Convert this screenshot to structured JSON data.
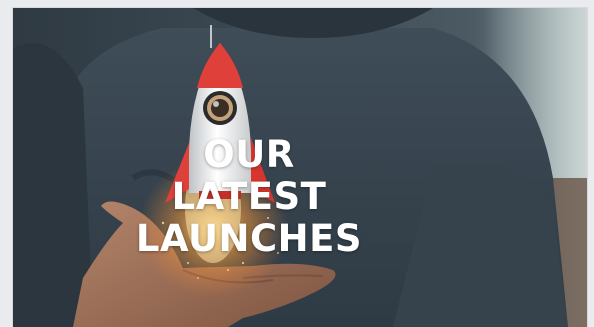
{
  "hero": {
    "title_line1": "OUR LATEST",
    "title_line2": "LAUNCHES",
    "image_subject": "hand holding a launching toy rocket",
    "colors": {
      "shirt": "#3a4a55",
      "rocket_red": "#e0403a",
      "rocket_body": "#f2f2f2",
      "glow": "#ffb24a",
      "title": "#ffffff"
    }
  }
}
